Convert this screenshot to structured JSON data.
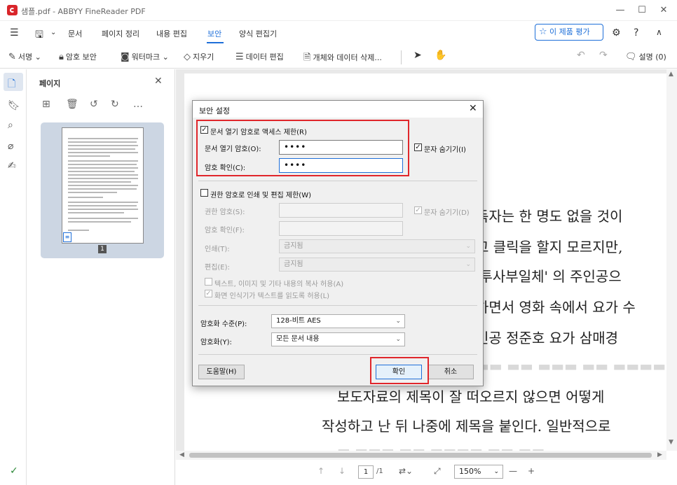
{
  "window": {
    "title": "샘플.pdf - ABBYY FineReader PDF"
  },
  "menubar": {
    "items": [
      "문서",
      "페이지 정리",
      "내용 편집",
      "보안",
      "양식 편집기"
    ],
    "active": "보안",
    "rate_button": "이 제품 평가"
  },
  "toolbar": {
    "sign": "서명",
    "password_security": "암호 보안",
    "watermark": "워터마크",
    "erase": "지우기",
    "data_edit": "데이터 편집",
    "delete_objects": "개체와 데이터 삭제...",
    "comments": "설명 (0)"
  },
  "page_panel": {
    "title": "페이지",
    "page_number": "1"
  },
  "document": {
    "lines": [
      "독자는 한 명도 없을 것이",
      "고 클릭을 할지 모르지만,",
      "'투사부일체' 의 주인공으",
      "하면서 영화 속에서 요가 수",
      "인공 정준호 요가 삼매경",
      "보도자료의 제목이 잘 떠오르지 않으면 어떻게",
      "작성하고 난 뒤 나중에 제목을 붙인다. 일반적으로"
    ]
  },
  "bottombar": {
    "current_page": "1",
    "total_pages": "/1",
    "zoom": "150%"
  },
  "dialog": {
    "title": "보안 설정",
    "open_password_section": {
      "checkbox_label": "문서 열기 암호로 액세스 제한(R)",
      "checked": true,
      "password_label": "문서 열기 암호(O):",
      "password_value": "••••",
      "confirm_label": "암호 확인(C):",
      "confirm_value": "••••",
      "hide_chars_label": "문자 숨기기(I)",
      "hide_chars_checked": true
    },
    "permissions_section": {
      "checkbox_label": "권한 암호로 인쇄 및 편집 제한(W)",
      "checked": false,
      "permission_password_label": "권한 암호(S):",
      "confirm_label": "암호 확인(F):",
      "hide_chars_label": "문자 숨기기(D)",
      "print_label": "인쇄(T):",
      "print_value": "금지됨",
      "edit_label": "편집(E):",
      "edit_value": "금지됨",
      "allow_copy_label": "텍스트, 이미지 및 기타 내용의 복사 허용(A)",
      "allow_screenreader_label": "화면 인식기가 텍스트를 읽도록 허용(L)"
    },
    "encryption": {
      "level_label": "암호화 수준(P):",
      "level_value": "128-비트 AES",
      "encrypt_label": "암호화(Y):",
      "encrypt_value": "모든 문서 내용"
    },
    "buttons": {
      "help": "도움말(H)",
      "ok": "확인",
      "cancel": "취소"
    }
  },
  "colors": {
    "accent": "#1e6fd9",
    "highlight": "#e0262b",
    "brand": "#d9252a"
  }
}
